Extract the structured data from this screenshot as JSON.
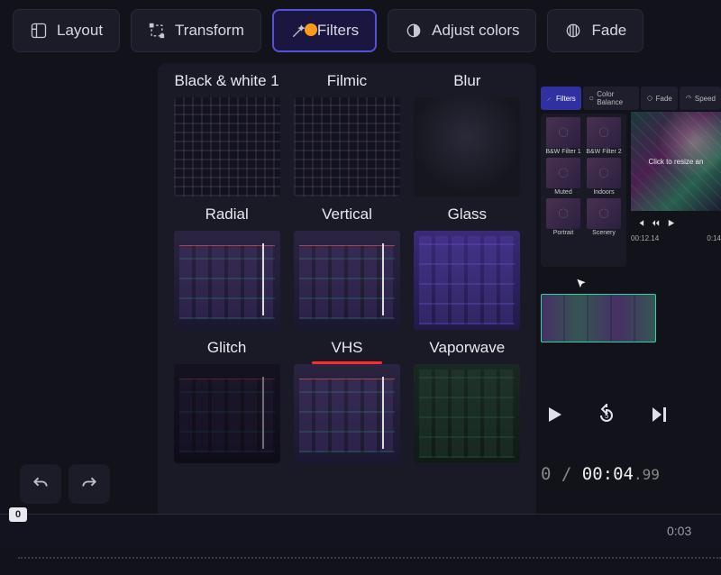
{
  "toolbar": {
    "layout": "Layout",
    "transform": "Transform",
    "filters": "Filters",
    "adjust_colors": "Adjust colors",
    "fade": "Fade"
  },
  "filters_panel": {
    "items": [
      "Black & white 1",
      "Filmic",
      "Blur",
      "Radial",
      "Vertical",
      "Glass",
      "Glitch",
      "VHS",
      "Vaporwave"
    ]
  },
  "mini_tabs": {
    "filters": "Filters",
    "color_balance": "Color Balance",
    "fade": "Fade",
    "speed": "Speed"
  },
  "mini_filters": {
    "items": [
      "B&W Filter 1",
      "B&W Filter 2",
      "Muted",
      "Indoors",
      "Portrait",
      "Scenery"
    ]
  },
  "video_hint": "Click to resize an",
  "mini_times": {
    "left": "00:12.14",
    "right": "0:14"
  },
  "timecode": {
    "separator": "0 / ",
    "current": "00:04",
    "ms": ".99"
  },
  "ruler": {
    "zero": "0",
    "mark": "0:03"
  }
}
